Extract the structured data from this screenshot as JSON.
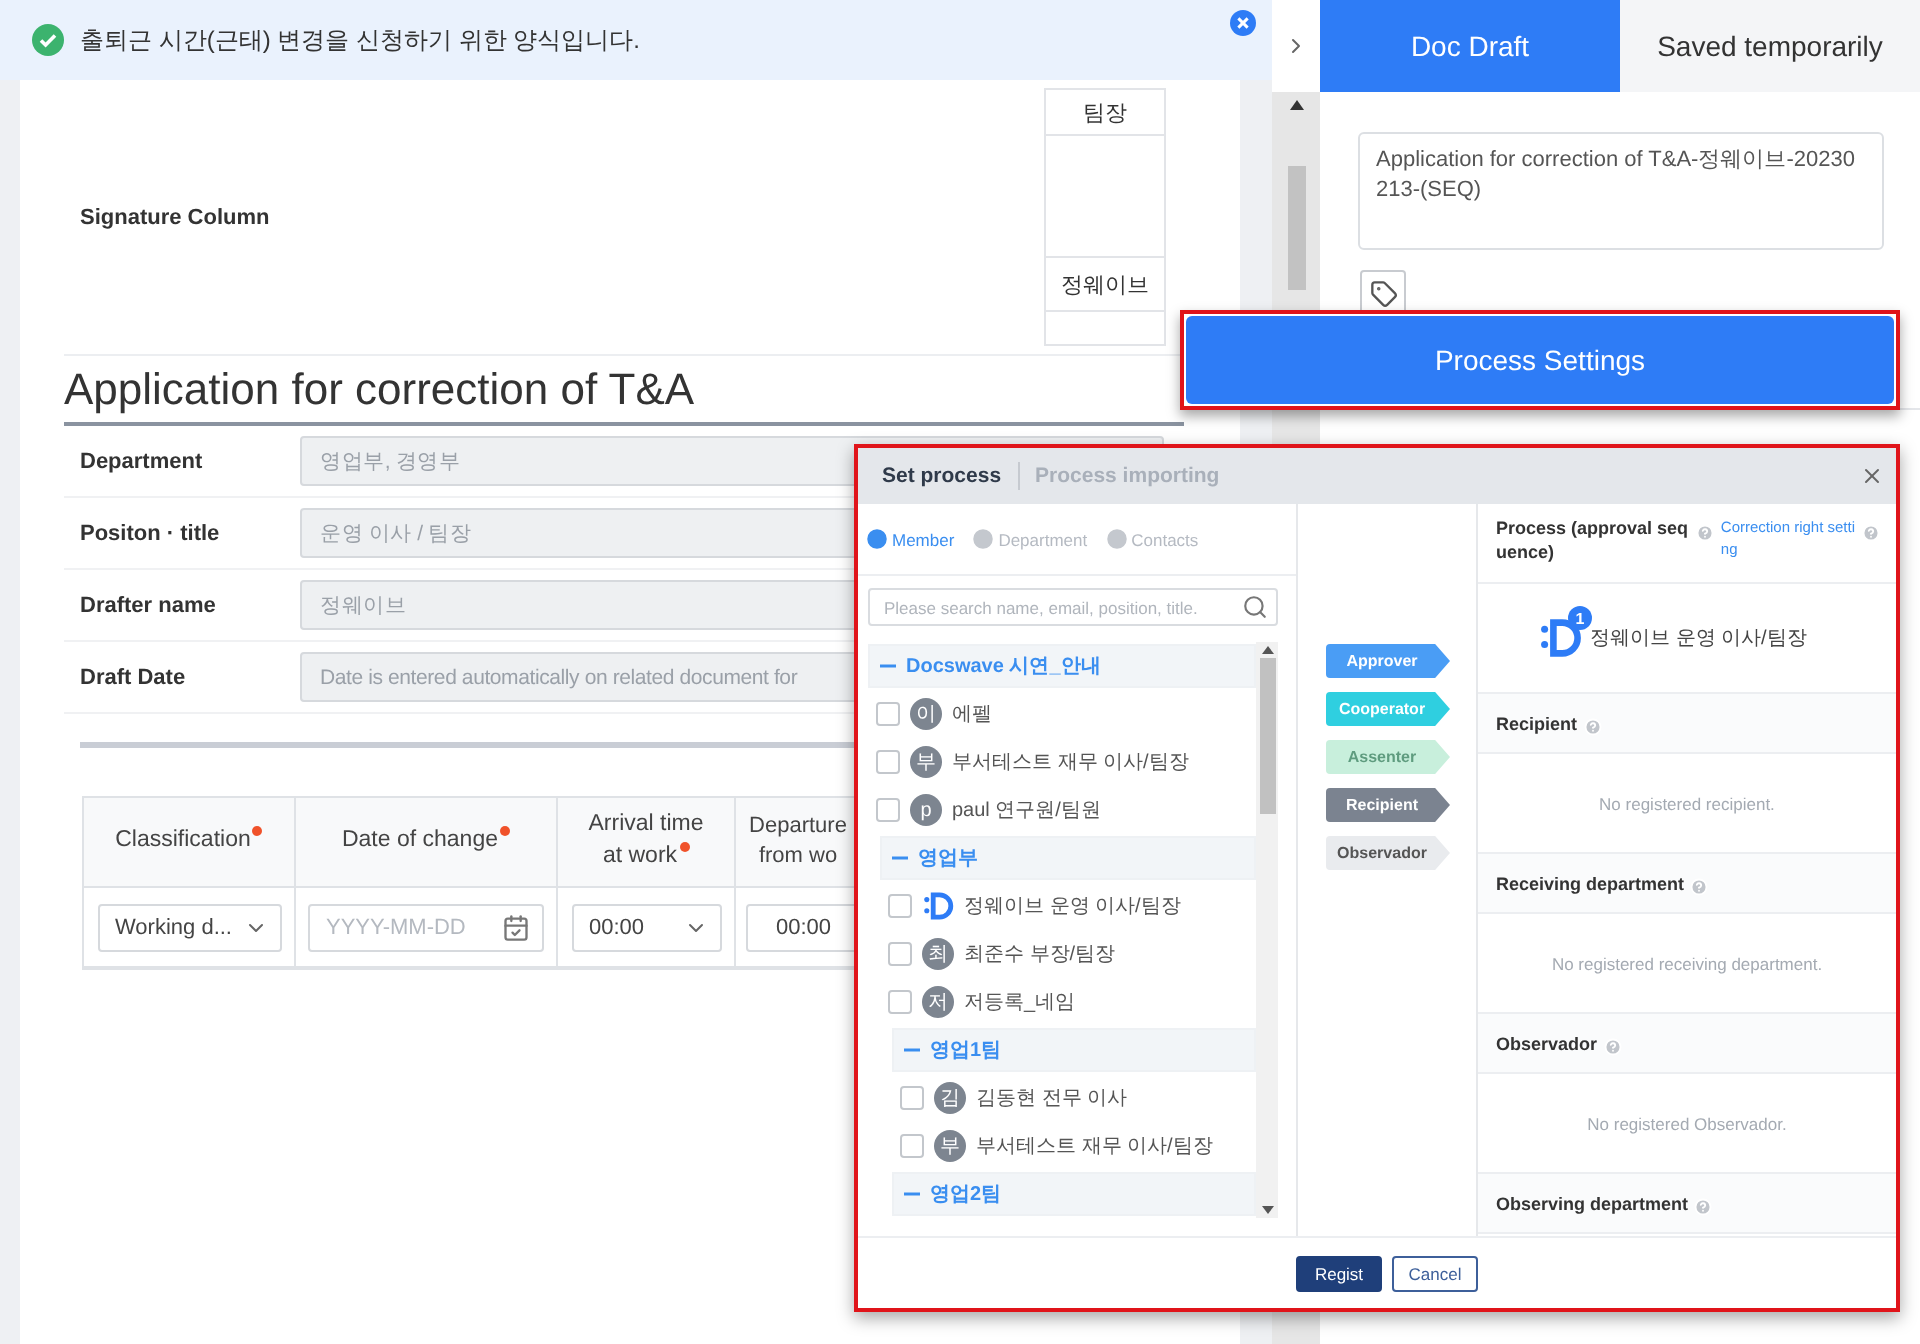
{
  "notice": {
    "text": "출퇴근 시간(근태) 변경을 신청하기 위한 양식입니다."
  },
  "signature": {
    "label": "Signature Column",
    "slots": [
      {
        "title": "팀장",
        "name": "정웨이브"
      }
    ]
  },
  "form": {
    "title": "Application for correction of T&A",
    "fields": [
      {
        "label": "Department",
        "value": "영업부, 경영부"
      },
      {
        "label": "Positon · title",
        "value": "운영 이사 / 팀장"
      },
      {
        "label": "Drafter name",
        "value": "정웨이브"
      },
      {
        "label": "Draft Date",
        "value": "Date is entered automatically on related document for"
      }
    ]
  },
  "table": {
    "columns": [
      {
        "label": "Classification",
        "required": true
      },
      {
        "label": "Date of change",
        "required": true
      },
      {
        "label": "Arrival time at work",
        "required": true
      },
      {
        "label": "Departure from wo",
        "required": false
      }
    ],
    "row": [
      {
        "kind": "select",
        "value": "Working d..."
      },
      {
        "kind": "date",
        "placeholder": "YYYY-MM-DD"
      },
      {
        "kind": "select",
        "value": "00:00"
      },
      {
        "kind": "text",
        "value": "00:00"
      }
    ]
  },
  "side_panel": {
    "tabs": [
      {
        "label": "Doc Draft",
        "selected": true
      },
      {
        "label": "Saved temporarily",
        "selected": false
      }
    ],
    "doc_title": "Application for correction of T&A-정웨이브-20230213-(SEQ)",
    "action": "Process Settings"
  },
  "modal": {
    "tabs": [
      {
        "label": "Set process",
        "selected": true
      },
      {
        "label": "Process importing",
        "selected": false
      }
    ],
    "source_tabs": [
      {
        "label": "Member",
        "selected": true
      },
      {
        "label": "Department",
        "selected": false
      },
      {
        "label": "Contacts",
        "selected": false
      }
    ],
    "search": {
      "placeholder": "Please search name, email, position, title."
    },
    "tree": [
      {
        "kind": "group",
        "label": "Docswave 시연_안내",
        "expanded": true,
        "children": [
          {
            "kind": "member",
            "initial": "이",
            "label": "에펠",
            "checked": false
          },
          {
            "kind": "member",
            "initial": "부",
            "label": "부서테스트 재무 이사/팀장",
            "checked": false
          },
          {
            "kind": "member",
            "initial": "p",
            "label": "paul 연구원/팀원",
            "checked": false
          },
          {
            "kind": "group",
            "label": "영업부",
            "expanded": true,
            "children": [
              {
                "kind": "member",
                "label": "정웨이브 운영 이사/팀장",
                "checked": false
              },
              {
                "kind": "member",
                "initial": "최",
                "label": "최준수 부장/팀장",
                "checked": false
              },
              {
                "kind": "member",
                "initial": "저",
                "label": "저등록_네임",
                "checked": false
              },
              {
                "kind": "group",
                "label": "영업1팀",
                "expanded": true,
                "children": [
                  {
                    "kind": "member",
                    "initial": "김",
                    "label": "김동현 전무 이사",
                    "checked": false
                  },
                  {
                    "kind": "member",
                    "initial": "부",
                    "label": "부서테스트 재무 이사/팀장",
                    "checked": false
                  }
                ]
              },
              {
                "kind": "group",
                "label": "영업2팀",
                "expanded": true
              }
            ]
          }
        ]
      }
    ],
    "roles": [
      {
        "label": "Approver",
        "color": "#4a9df5",
        "disabled": false
      },
      {
        "label": "Cooperator",
        "color": "#2fcfe0",
        "disabled": false
      },
      {
        "label": "Assenter",
        "color": "#c8efdc",
        "disabled": true
      },
      {
        "label": "Recipient",
        "color": "#7b8390",
        "disabled": false
      },
      {
        "label": "Observador",
        "color": "#e9ebee",
        "disabled": false
      }
    ],
    "process": {
      "title": "Process (approval sequence)",
      "link": "Correction right setting",
      "approvers": [
        {
          "order": "1",
          "name": "정웨이브 운영 이사/팀장"
        }
      ]
    },
    "sections": [
      {
        "title": "Recipient",
        "empty": "No registered recipient."
      },
      {
        "title": "Receiving department",
        "empty": "No registered receiving department."
      },
      {
        "title": "Observador",
        "empty": "No registered Observador."
      },
      {
        "title": "Observing department"
      }
    ],
    "buttons": [
      {
        "label": "Regist",
        "kind": "primary"
      },
      {
        "label": "Cancel",
        "kind": "secondary"
      }
    ]
  }
}
